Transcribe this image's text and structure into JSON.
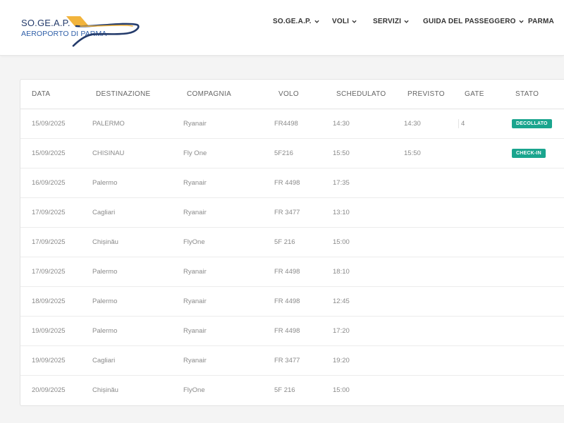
{
  "header": {
    "logo": {
      "line1": "SO.GE.A.P.",
      "line2": "AEROPORTO DI PARMA",
      "colors": {
        "navy": "#243b6b",
        "blue": "#2f5fa8",
        "gold": "#f2b43c"
      }
    },
    "nav": [
      {
        "label": "SO.GE.A.P.",
        "icon": "chevron-down-icon"
      },
      {
        "label": "VOLI",
        "icon": "chevron-down-icon"
      },
      {
        "label": "SERVIZI",
        "icon": "chevron-down-icon"
      },
      {
        "label": "GUIDA DEL PASSEGGERO",
        "icon": "chevron-down-icon"
      },
      {
        "label": "PARMA",
        "icon": ""
      }
    ]
  },
  "table": {
    "columns": [
      "DATA",
      "DESTINAZIONE",
      "COMPAGNIA",
      "VOLO",
      "SCHEDULATO",
      "PREVISTO",
      "GATE",
      "STATO"
    ],
    "rows": [
      {
        "data": "15/09/2025",
        "destinazione": "PALERMO",
        "compagnia": "Ryanair",
        "volo": "FR4498",
        "schedulato": "14:30",
        "previsto": "14:30",
        "gate": "4",
        "stato": "DECOLLATO"
      },
      {
        "data": "15/09/2025",
        "destinazione": "CHISINAU",
        "compagnia": "Fly One",
        "volo": "5F216",
        "schedulato": "15:50",
        "previsto": "15:50",
        "gate": "",
        "stato": "CHECK-IN"
      },
      {
        "data": "16/09/2025",
        "destinazione": "Palermo",
        "compagnia": "Ryanair",
        "volo": "FR 4498",
        "schedulato": "17:35",
        "previsto": "",
        "gate": "",
        "stato": ""
      },
      {
        "data": "17/09/2025",
        "destinazione": "Cagliari",
        "compagnia": "Ryanair",
        "volo": "FR 3477",
        "schedulato": "13:10",
        "previsto": "",
        "gate": "",
        "stato": ""
      },
      {
        "data": "17/09/2025",
        "destinazione": "Chișinău",
        "compagnia": "FlyOne",
        "volo": "5F 216",
        "schedulato": "15:00",
        "previsto": "",
        "gate": "",
        "stato": ""
      },
      {
        "data": "17/09/2025",
        "destinazione": "Palermo",
        "compagnia": "Ryanair",
        "volo": "FR 4498",
        "schedulato": "18:10",
        "previsto": "",
        "gate": "",
        "stato": ""
      },
      {
        "data": "18/09/2025",
        "destinazione": "Palermo",
        "compagnia": "Ryanair",
        "volo": "FR 4498",
        "schedulato": "12:45",
        "previsto": "",
        "gate": "",
        "stato": ""
      },
      {
        "data": "19/09/2025",
        "destinazione": "Palermo",
        "compagnia": "Ryanair",
        "volo": "FR 4498",
        "schedulato": "17:20",
        "previsto": "",
        "gate": "",
        "stato": ""
      },
      {
        "data": "19/09/2025",
        "destinazione": "Cagliari",
        "compagnia": "Ryanair",
        "volo": "FR 3477",
        "schedulato": "19:20",
        "previsto": "",
        "gate": "",
        "stato": ""
      },
      {
        "data": "20/09/2025",
        "destinazione": "Chișinău",
        "compagnia": "FlyOne",
        "volo": "5F 216",
        "schedulato": "15:00",
        "previsto": "",
        "gate": "",
        "stato": ""
      }
    ],
    "status_color": "#1aa58e"
  }
}
